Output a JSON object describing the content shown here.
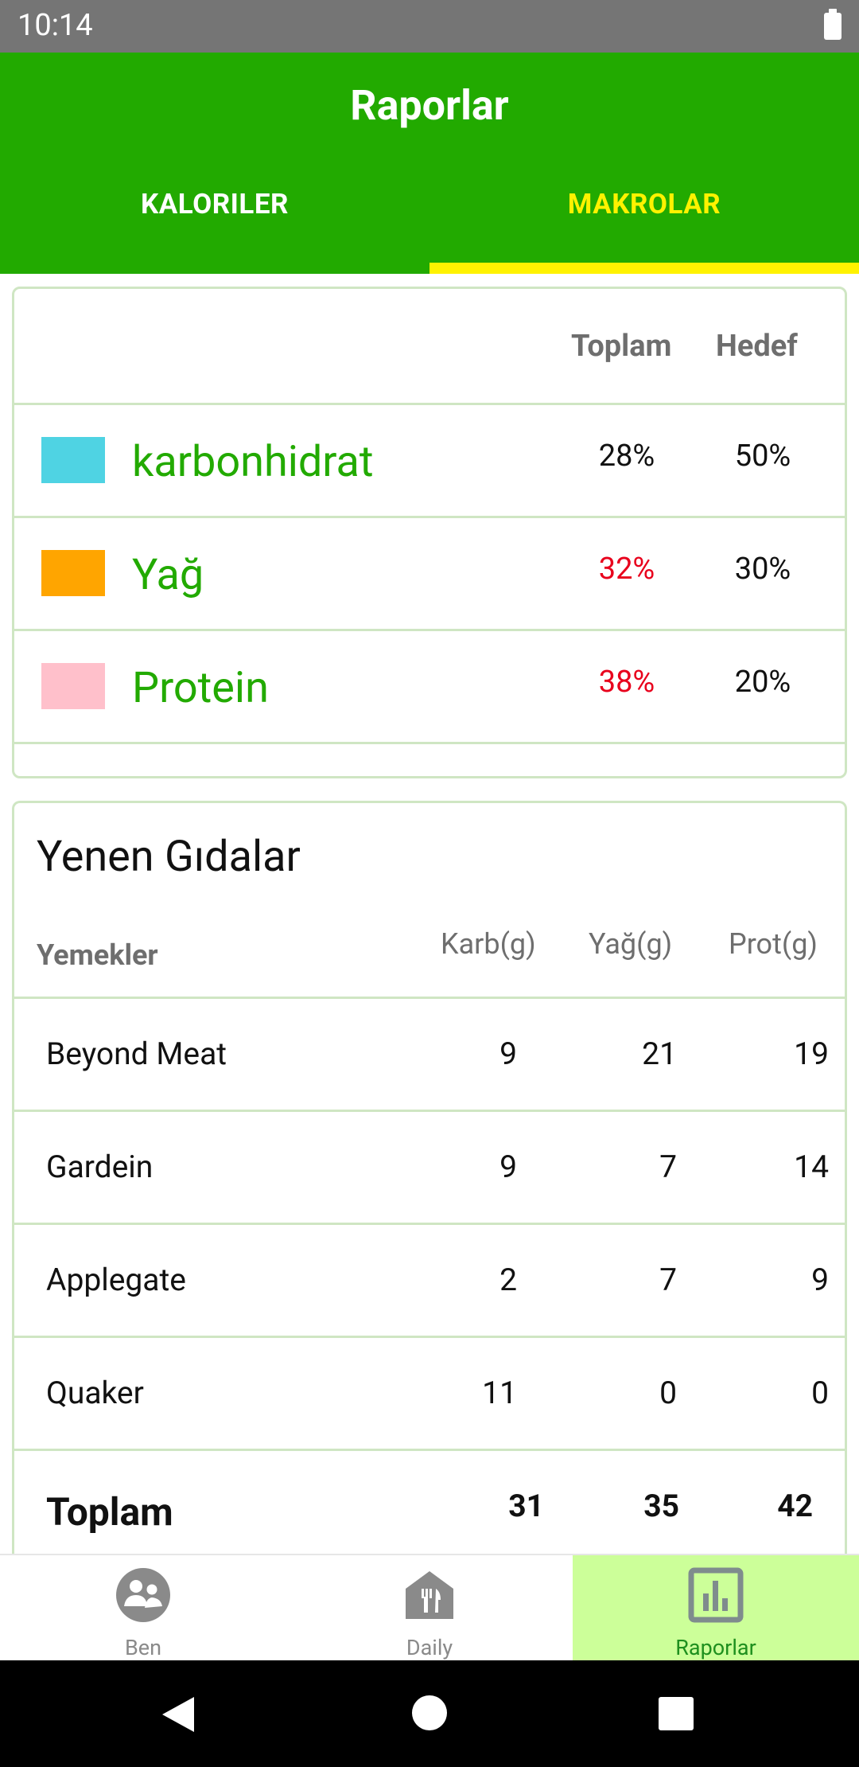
{
  "status_bar": {
    "time": "10:14"
  },
  "header": {
    "title": "Raporlar",
    "tabs": [
      {
        "label": "KALORILER",
        "active": false
      },
      {
        "label": "MAKROLAR",
        "active": true
      }
    ]
  },
  "macros": {
    "columns": {
      "total": "Toplam",
      "target": "Hedef"
    },
    "rows": [
      {
        "name": "karbonhidrat",
        "color": "#4fd3e3",
        "total": "28%",
        "target": "50%",
        "over_target": false
      },
      {
        "name": "Yağ",
        "color": "#ffa500",
        "total": "32%",
        "target": "30%",
        "over_target": true
      },
      {
        "name": "Protein",
        "color": "#ffc0cb",
        "total": "38%",
        "target": "20%",
        "over_target": true
      }
    ]
  },
  "foods": {
    "title": "Yenen Gıdalar",
    "columns": {
      "food": "Yemekler",
      "carb": "Karb(g)",
      "fat": "Yağ(g)",
      "protein": "Prot(g)"
    },
    "rows": [
      {
        "name": "Beyond Meat",
        "carb": "9",
        "fat": "21",
        "protein": "19"
      },
      {
        "name": "Gardein",
        "carb": "9",
        "fat": "7",
        "protein": "14"
      },
      {
        "name": "Applegate",
        "carb": "2",
        "fat": "7",
        "protein": "9"
      },
      {
        "name": "Quaker",
        "carb": "11",
        "fat": "0",
        "protein": "0"
      }
    ],
    "total": {
      "label": "Toplam",
      "carb": "31",
      "fat": "35",
      "protein": "42"
    }
  },
  "bottom_nav": {
    "items": [
      {
        "label": "Ben",
        "icon": "people-icon",
        "active": false
      },
      {
        "label": "Daily",
        "icon": "restaurant-house-icon",
        "active": false
      },
      {
        "label": "Raporlar",
        "icon": "bar-chart-icon",
        "active": true
      }
    ]
  },
  "colors": {
    "brand": "#22aa00",
    "accent": "#fff200",
    "over_target": "#e8001c",
    "active_nav_bg": "#ccff99"
  }
}
